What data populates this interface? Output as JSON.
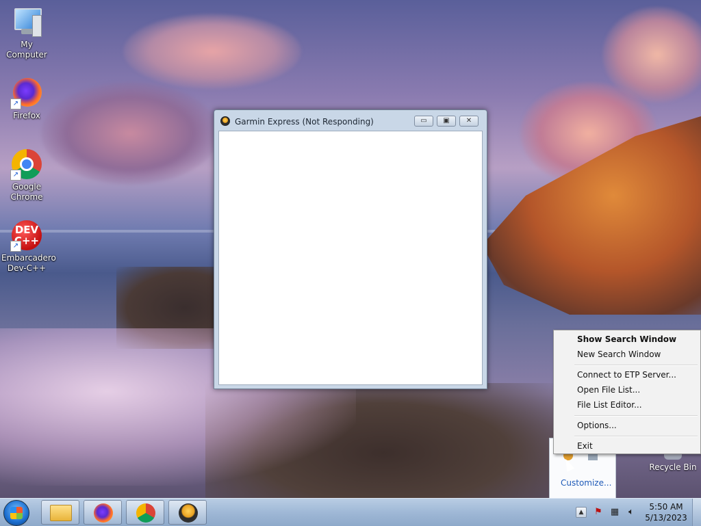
{
  "desktop": {
    "icons": [
      {
        "label": "My Computer",
        "icon": "computer-icon"
      },
      {
        "label": "Firefox",
        "icon": "firefox-icon"
      },
      {
        "label": "Google Chrome",
        "icon": "chrome-icon"
      },
      {
        "label": "Embarcadero Dev-C++",
        "icon": "devcpp-icon"
      }
    ],
    "dev_logo_text": "DEV C++",
    "recycle_bin": "Recycle Bin"
  },
  "window": {
    "title": "Garmin Express (Not Responding)",
    "minimize": "▭",
    "maximize": "▣",
    "close": "✕"
  },
  "tray_overflow": {
    "customize": "Customize..."
  },
  "context_menu": {
    "items": [
      {
        "label": "Show Search Window",
        "bold": true
      },
      {
        "label": "New Search Window"
      },
      {
        "label": "Connect to ETP Server..."
      },
      {
        "label": "Open File List..."
      },
      {
        "label": "File List Editor..."
      },
      {
        "label": "Options..."
      },
      {
        "label": "Exit"
      }
    ]
  },
  "taskbar": {
    "pinned": [
      "explorer-icon",
      "firefox-icon",
      "chrome-icon",
      "garmin-icon"
    ],
    "tray_up_arrow": "▲",
    "clock_time": "5:50 AM",
    "clock_date": "5/13/2023"
  },
  "colors": {
    "taskbar": "#9fb8d6",
    "link": "#1e5ab8"
  }
}
